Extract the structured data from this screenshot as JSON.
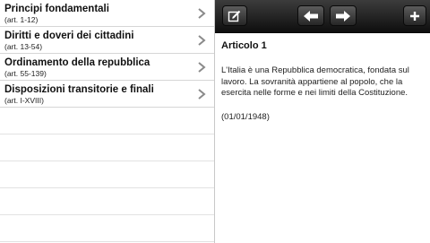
{
  "sections": [
    {
      "title": "Principi fondamentali",
      "range": "(art. 1-12)"
    },
    {
      "title": "Diritti e doveri dei cittadini",
      "range": "(art. 13-54)"
    },
    {
      "title": "Ordinamento della repubblica",
      "range": "(art. 55-139)"
    },
    {
      "title": "Disposizioni transitorie e finali",
      "range": "(art. I-XVIII)"
    }
  ],
  "toolbar": {
    "edit_icon": "edit-icon",
    "back_icon": "arrow-left-icon",
    "forward_icon": "arrow-right-icon",
    "add_icon": "plus-icon"
  },
  "article": {
    "title": "Articolo 1",
    "text": "L'Italia è una Repubblica democratica, fondata sul lavoro. La sovranità appartiene al popolo, che la esercita nelle forme e nei limiti della Costituzione.",
    "date": "(01/01/1948)"
  },
  "colors": {
    "toolbar_dark": "#0e0e0e",
    "toolbar_light": "#3c3c3c",
    "chevron": "#8a8a8a"
  }
}
